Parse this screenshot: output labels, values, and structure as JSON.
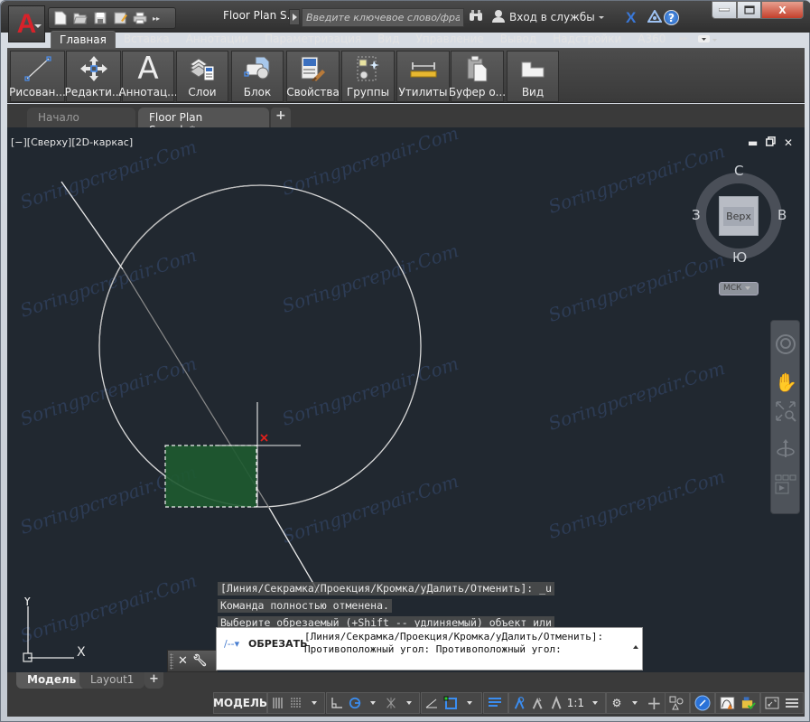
{
  "app": {
    "logo_letter": "A",
    "document_title": "Floor Plan S...",
    "search_placeholder": "Введите ключевое слово/фразу",
    "signin_label": "Вход в службы",
    "help_label": "?",
    "qat_icons": [
      "new-icon",
      "open-icon",
      "save-icon",
      "save-as-icon",
      "plot-icon"
    ],
    "window_controls": {
      "minimize": "–",
      "maximize": "□",
      "close": "X"
    }
  },
  "ribbon_tabs": [
    {
      "label": "Главная",
      "active": true
    },
    {
      "label": "Вставка",
      "active": false
    },
    {
      "label": "Аннотации",
      "active": false
    },
    {
      "label": "Параметризация",
      "active": false
    },
    {
      "label": "Вид",
      "active": false
    },
    {
      "label": "Управление",
      "active": false
    },
    {
      "label": "Вывод",
      "active": false
    },
    {
      "label": "Надстройки",
      "active": false
    },
    {
      "label": "A360",
      "active": false
    }
  ],
  "ribbon_panels": [
    {
      "label": "Рисован...",
      "icon": "line-icon"
    },
    {
      "label": "Редакти...",
      "icon": "move-icon"
    },
    {
      "label": "Аннотац...",
      "icon": "text-icon"
    },
    {
      "label": "Слои",
      "icon": "layers-icon"
    },
    {
      "label": "Блок",
      "icon": "block-icon"
    },
    {
      "label": "Свойства",
      "icon": "properties-icon"
    },
    {
      "label": "Группы",
      "icon": "groups-icon"
    },
    {
      "label": "Утилиты",
      "icon": "measure-icon"
    },
    {
      "label": "Буфер о...",
      "icon": "clipboard-icon"
    },
    {
      "label": "Вид",
      "icon": "view-icon"
    }
  ],
  "file_tabs": [
    {
      "label": "Начало",
      "active": false
    },
    {
      "label": "Floor Plan Sample*",
      "active": true,
      "close": "✕"
    }
  ],
  "viewport": {
    "label": "[−][Сверху][2D-каркас]",
    "viewcube": {
      "face": "Верх",
      "north": "С",
      "south": "Ю",
      "east": "В",
      "west": "З"
    },
    "wcs_label": "МСК",
    "ucs": {
      "x": "X",
      "y": "Y"
    },
    "watermark": "Soringpcrepair.Com"
  },
  "command": {
    "history": [
      "[Линия/Секрамка/Проекция/Кромка/уДалить/Отменить]: _u",
      "Команда полностью отменена.",
      "Выберите обрезаемый (+Shift -- удлиняемый) объект или"
    ],
    "current_name": "ОБРЕЗАТЬ",
    "current_text": "[Линия/Секрамка/Проекция/Кромка/уДалить/Отменить]:\nПротивоположный угол: Противоположный угол:"
  },
  "layout_tabs": [
    {
      "label": "Модель",
      "active": true
    },
    {
      "label": "Layout1",
      "active": false
    }
  ],
  "statusbar": {
    "model_label": "МОДЕЛЬ",
    "scale_label": "1:1"
  },
  "colors": {
    "canvas": "#212830",
    "selection_fill": "#1e5a30",
    "accent_blue": "#3b8df0",
    "autocad_red": "#d8222a",
    "marker_red": "#e0201c"
  }
}
